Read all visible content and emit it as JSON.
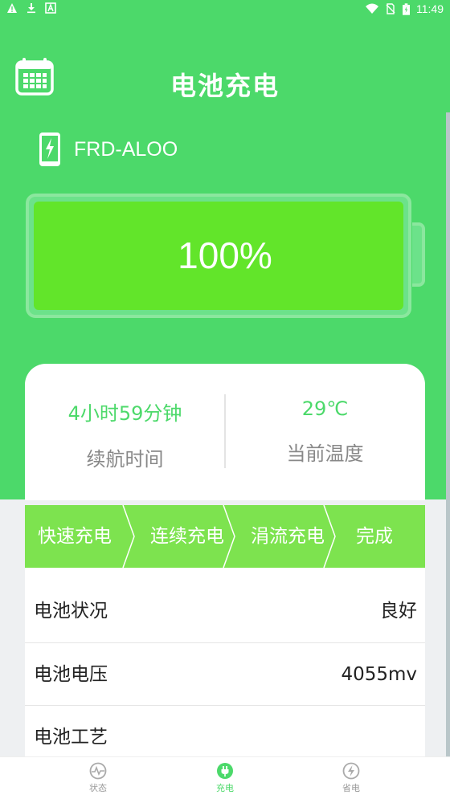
{
  "status_bar": {
    "time": "11:49",
    "left_icons": [
      "warning-icon",
      "download-icon",
      "text-icon"
    ],
    "right_icons": [
      "wifi-icon",
      "no-sim-icon",
      "battery-charging-icon"
    ]
  },
  "header": {
    "title": "电池充电",
    "left_icon": "calendar-icon"
  },
  "device": {
    "icon": "phone-charging-icon",
    "name": "FRD-ALOO"
  },
  "battery": {
    "percent_label": "100%",
    "level": 1.0
  },
  "info": {
    "endurance_value": "4小时59分钟",
    "endurance_label": "续航时间",
    "temperature_value": "29℃",
    "temperature_label": "当前温度"
  },
  "steps": [
    {
      "label": "快速充电"
    },
    {
      "label": "连续充电"
    },
    {
      "label": "涓流充电"
    },
    {
      "label": "完成"
    }
  ],
  "details": [
    {
      "label": "电池状况",
      "value": "良好"
    },
    {
      "label": "电池电压",
      "value": "4055mv"
    },
    {
      "label": "电池工艺",
      "value": ""
    }
  ],
  "tabs": [
    {
      "label": "状态",
      "icon": "pulse-icon",
      "active": false
    },
    {
      "label": "充电",
      "icon": "plug-icon",
      "active": true
    },
    {
      "label": "省电",
      "icon": "bolt-icon",
      "active": false
    }
  ],
  "colors": {
    "primary": "#4cd96a",
    "battery_fill": "#62e52a",
    "steps_bg": "#7de34f"
  }
}
